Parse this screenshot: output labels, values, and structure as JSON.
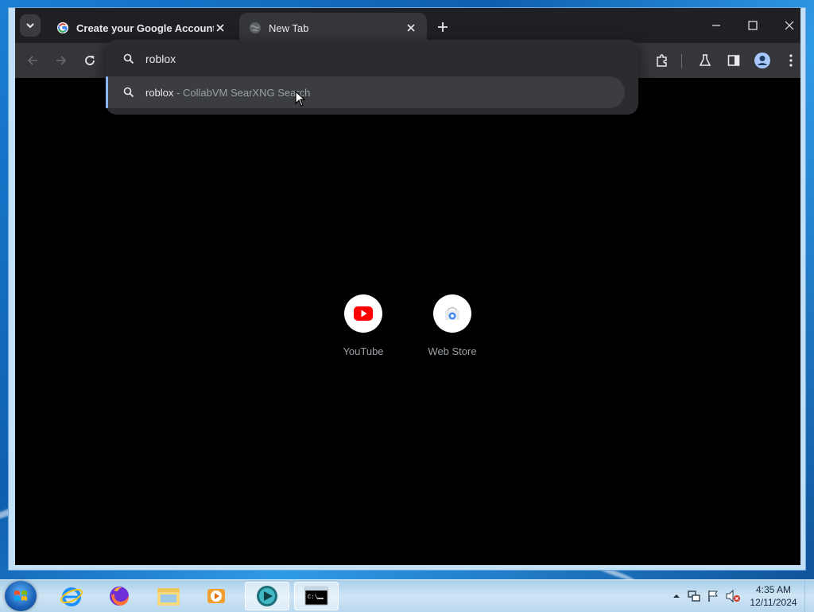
{
  "browser": {
    "tabs": [
      {
        "title": "Create your Google Account",
        "active": false
      },
      {
        "title": "New Tab",
        "active": true
      }
    ]
  },
  "omnibox": {
    "input_value": "roblox",
    "suggestion": {
      "main": "roblox",
      "separator": " - ",
      "description": "CollabVM SearXNG Search"
    }
  },
  "shortcuts": [
    {
      "label": "YouTube",
      "icon": "youtube-icon"
    },
    {
      "label": "Web Store",
      "icon": "webstore-icon"
    }
  ],
  "taskbar": {
    "pinned": [
      "internet-explorer-icon",
      "firefox-icon",
      "file-explorer-icon",
      "media-player-icon",
      "chromium-icon",
      "command-prompt-icon"
    ],
    "clock_time": "4:35 AM",
    "clock_date": "12/11/2024"
  },
  "colors": {
    "accent": "#8ab4f8",
    "tabstrip": "#1f2023",
    "toolbar": "#35363a",
    "youtube_red": "#ff0000"
  }
}
